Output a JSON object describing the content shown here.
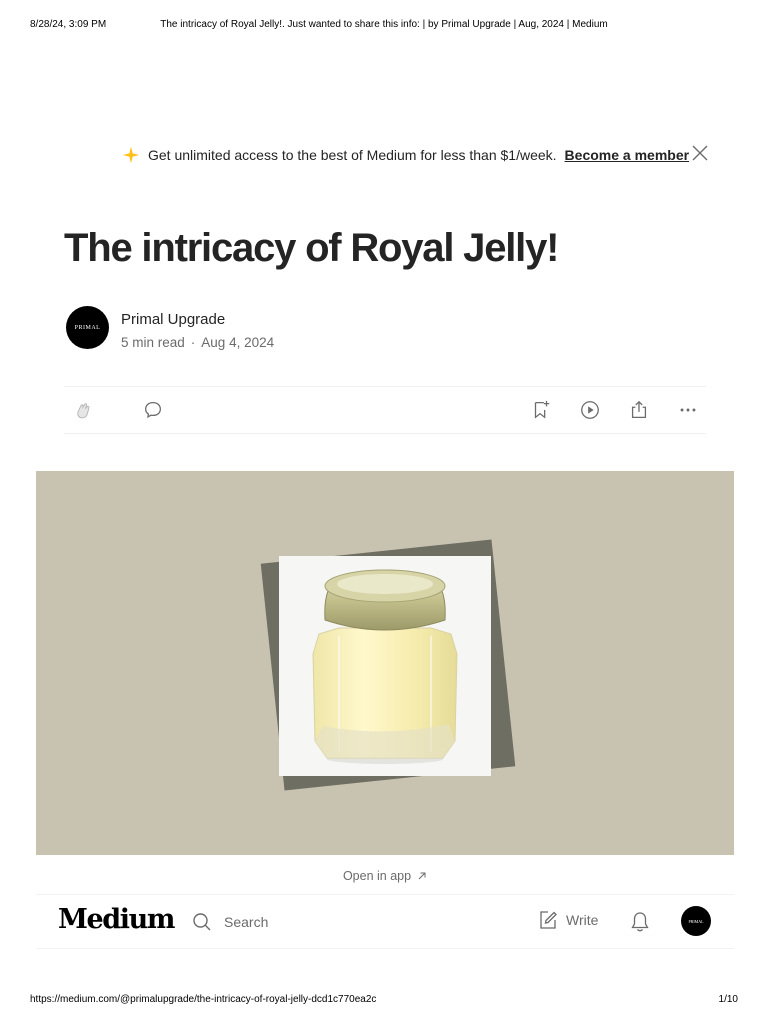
{
  "print": {
    "date": "8/28/24, 3:09 PM",
    "title": "The intricacy of Royal Jelly!. Just wanted to share this info: | by Primal Upgrade | Aug, 2024 | Medium",
    "url": "https://medium.com/@primalupgrade/the-intricacy-of-royal-jelly-dcd1c770ea2c",
    "page": "1/10"
  },
  "banner": {
    "text": "Get unlimited access to the best of Medium for less than $1/week.",
    "cta": "Become a member",
    "star_color": "#FFC017"
  },
  "article": {
    "title": "The intricacy of Royal Jelly!",
    "author": "Primal Upgrade",
    "avatar_text": "PRIMAL",
    "read_time": "5 min read",
    "separator": "·",
    "date": "Aug 4, 2024"
  },
  "actions": {
    "icons": [
      "clap-icon",
      "comment-icon",
      "bookmark-add-icon",
      "play-icon",
      "share-icon",
      "more-icon"
    ]
  },
  "hero": {
    "background": "#C8C3B1",
    "subject": "jar-of-royal-jelly"
  },
  "open_in_app": {
    "label": "Open in app"
  },
  "nav": {
    "logo": "Medium",
    "search_placeholder": "Search",
    "write_label": "Write",
    "avatar_text": "PRIMAL"
  }
}
